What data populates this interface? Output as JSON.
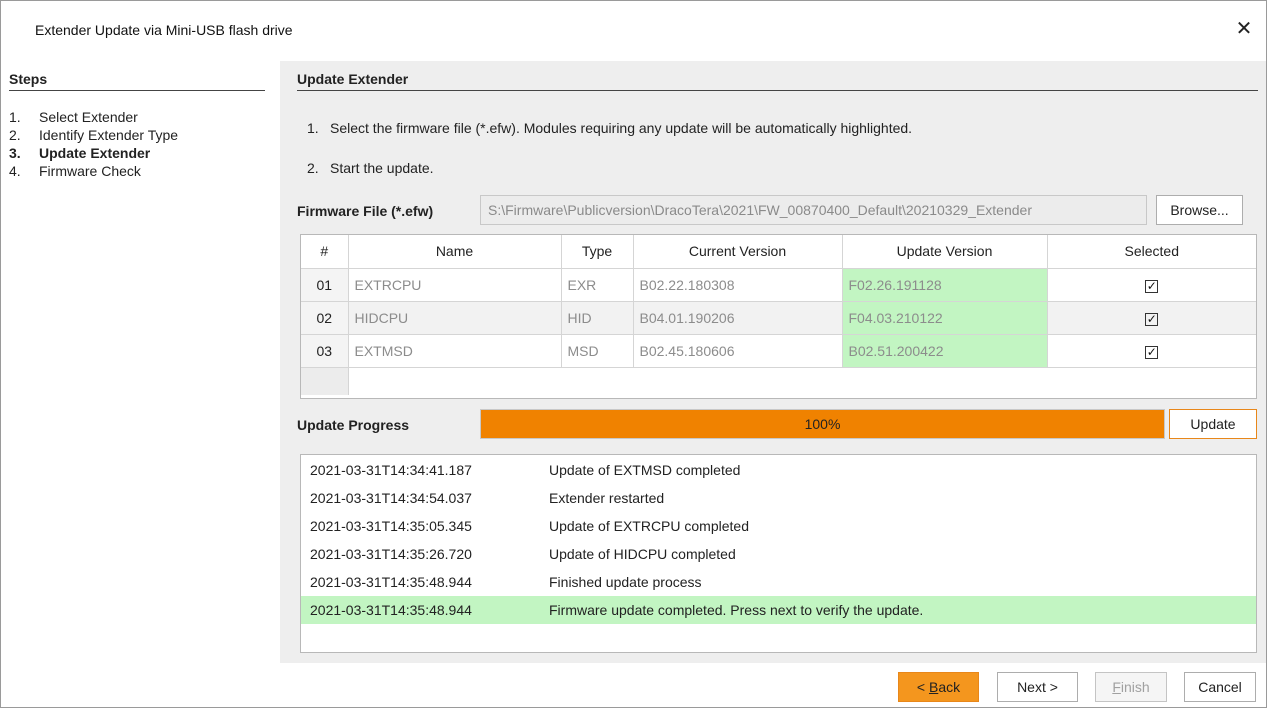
{
  "window": {
    "title": "Extender Update via Mini-USB flash drive",
    "close_glyph": "✕"
  },
  "steps": {
    "title": "Steps",
    "items": [
      {
        "num": "1.",
        "label": "Select Extender"
      },
      {
        "num": "2.",
        "label": "Identify Extender Type"
      },
      {
        "num": "3.",
        "label": "Update Extender"
      },
      {
        "num": "4.",
        "label": "Firmware Check"
      }
    ]
  },
  "main": {
    "title": "Update Extender",
    "instructions": [
      {
        "num": "1.",
        "text": "Select the firmware file (*.efw). Modules requiring any update will be automatically highlighted."
      },
      {
        "num": "2.",
        "text": "Start the update."
      }
    ],
    "firmware_label": "Firmware File (*.efw)",
    "firmware_path": "S:\\Firmware\\Publicversion\\DracoTera\\2021\\FW_00870400_Default\\20210329_Extender",
    "browse_label": "Browse..."
  },
  "table": {
    "headers": [
      "#",
      "Name",
      "Type",
      "Current Version",
      "Update Version",
      "Selected"
    ],
    "rows": [
      {
        "idx": "01",
        "name": "EXTRCPU",
        "type": "EXR",
        "current": "B02.22.180308",
        "update": "F02.26.191128",
        "selected": "✓"
      },
      {
        "idx": "02",
        "name": "HIDCPU",
        "type": "HID",
        "current": "B04.01.190206",
        "update": "F04.03.210122",
        "selected": "✓"
      },
      {
        "idx": "03",
        "name": "EXTMSD",
        "type": "MSD",
        "current": "B02.45.180606",
        "update": "B02.51.200422",
        "selected": "✓"
      }
    ]
  },
  "progress": {
    "label": "Update Progress",
    "text": "100%",
    "fraction": 1.0,
    "update_label": "Update"
  },
  "log": [
    {
      "ts": "2021-03-31T14:34:41.187",
      "msg": "Update of EXTMSD completed"
    },
    {
      "ts": "2021-03-31T14:34:54.037",
      "msg": "Extender restarted"
    },
    {
      "ts": "2021-03-31T14:35:05.345",
      "msg": "Update of EXTRCPU completed"
    },
    {
      "ts": "2021-03-31T14:35:26.720",
      "msg": "Update of HIDCPU completed"
    },
    {
      "ts": "2021-03-31T14:35:48.944",
      "msg": "Finished update process"
    },
    {
      "ts": "2021-03-31T14:35:48.944",
      "msg": "Firmware update completed. Press next to verify the update."
    }
  ],
  "footer": {
    "back_prefix": "< ",
    "back_key": "B",
    "back_rest": "ack",
    "next_label": "Next >",
    "finish_key": "F",
    "finish_rest": "inish",
    "cancel_label": "Cancel"
  },
  "colors": {
    "accent": "#f08200",
    "highlight": "#c2f5c2"
  }
}
